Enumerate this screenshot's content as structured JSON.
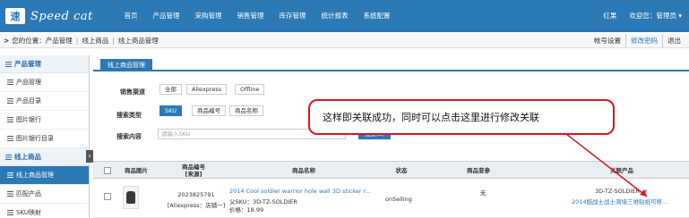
{
  "brand": {
    "logo_mark": "速",
    "name": "Speed cat"
  },
  "nav": [
    "首页",
    "产品管理",
    "采购管理",
    "销售管理",
    "库存管理",
    "统计报表",
    "系统配置"
  ],
  "user": {
    "name": "红果",
    "welcome": "欢迎您：管理员 ▾"
  },
  "breadcrumb": {
    "prefix": "您的位置：产品管理",
    "level2": "线上商品",
    "level3": "线上商品管理"
  },
  "account": {
    "settings": "帐号设置",
    "change_password": "修改密码",
    "logout": "退出"
  },
  "sidebar": {
    "group1": "产品管理",
    "group1_items": [
      "产品管理",
      "产品目录",
      "图片银行",
      "图片银行目录"
    ],
    "group2": "线上商品",
    "group2_items": [
      "线上商品管理",
      "匹配产品",
      "SKU映射"
    ]
  },
  "tab": "线上商品管理",
  "filters": {
    "channel_label": "销售渠道",
    "channel_options": [
      "全部",
      "Aliexpress",
      "Offline"
    ],
    "search_type_label": "搜索类型",
    "search_type_options": [
      "SKU",
      "商品编号",
      "商品名称"
    ],
    "search_content_label": "搜索内容",
    "search_placeholder": "请输入SKU",
    "search_button": "搜索(S)"
  },
  "table": {
    "headers": [
      "商品图片",
      "商品编号\n[来源]",
      "商品名称",
      "状态",
      "商品变参",
      "关联产品"
    ],
    "row": {
      "id": "2023825791",
      "source": "[Aliexpress：店铺一]",
      "title": "2014 Cool soldier warrior hole wall 3D sticker r...",
      "parent_sku": "父SKU：3D-TZ-SOLDIER",
      "price": "价格：18.99",
      "status": "onSelling",
      "variant": "无",
      "linked_sku": "3D-TZ-SOLDIER",
      "linked_name": "2014酷战士战士洞墙三维贴纸可移..."
    }
  },
  "callout": {
    "text": "这样即关联成功，同时可以点击这里进行修改关联"
  },
  "colors": {
    "primary": "#2b79b5",
    "callout_border": "#e0121f"
  }
}
